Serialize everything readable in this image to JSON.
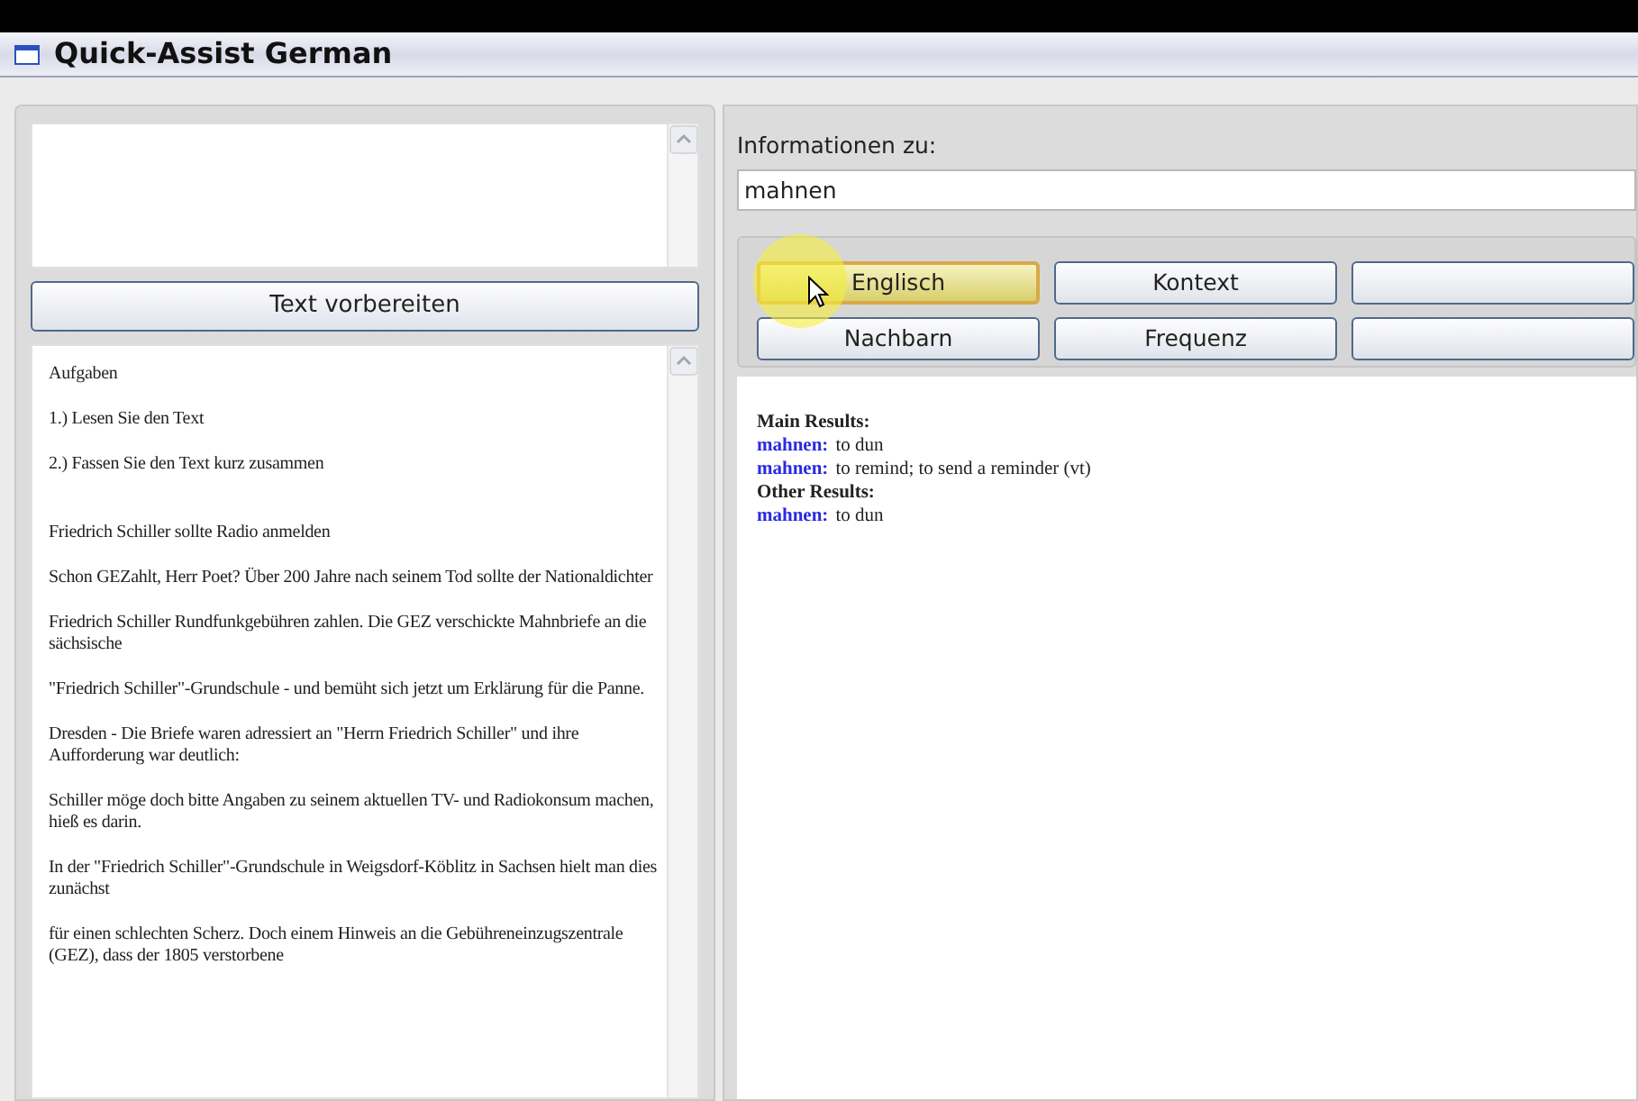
{
  "window": {
    "title": "Quick-Assist German"
  },
  "prepare_button": {
    "label": "Text vorbereiten"
  },
  "document": {
    "sections": [
      {
        "paragraphs": [
          "Aufgaben",
          "1.) Lesen Sie den Text",
          "2.) Fassen Sie den Text kurz zusammen"
        ]
      },
      {
        "paragraphs": [
          "Friedrich Schiller sollte Radio anmelden",
          "Schon GEZahlt, Herr Poet? Über 200 Jahre nach seinem Tod sollte der Nationaldichter",
          "Friedrich Schiller Rundfunkgebühren zahlen. Die GEZ verschickte Mahnbriefe an die sächsische",
          "\"Friedrich Schiller\"-Grundschule - und bemüht sich jetzt um Erklärung für die Panne.",
          "Dresden - Die Briefe waren adressiert an \"Herrn Friedrich Schiller\" und ihre Aufforderung war deutlich:",
          "Schiller möge doch bitte Angaben zu seinem aktuellen TV- und Radiokonsum machen, hieß es darin.",
          "In der \"Friedrich Schiller\"-Grundschule in Weigsdorf-Köblitz in Sachsen hielt man dies zunächst",
          "für einen schlechten Scherz. Doch einem Hinweis an die Gebühreneinzugszentrale (GEZ), dass der 1805 verstorbene"
        ]
      }
    ]
  },
  "info": {
    "label": "Informationen zu:",
    "value": "mahnen"
  },
  "buttons": [
    {
      "label": "Englisch",
      "selected": true
    },
    {
      "label": "Kontext",
      "selected": false
    },
    {
      "selected": false
    },
    {
      "label": "Nachbarn",
      "selected": false
    },
    {
      "label": "Frequenz",
      "selected": false
    },
    {
      "selected": false
    }
  ],
  "results": [
    {
      "kind": "heading",
      "text": "Main Results:"
    },
    {
      "kind": "entry",
      "term": "mahnen:",
      "text": "to dun"
    },
    {
      "kind": "entry",
      "term": "mahnen:",
      "text": "to remind; to send a reminder (vt)"
    },
    {
      "kind": "heading",
      "text": "Other Results:"
    },
    {
      "kind": "entry",
      "term": "mahnen:",
      "text": "to dun"
    }
  ]
}
